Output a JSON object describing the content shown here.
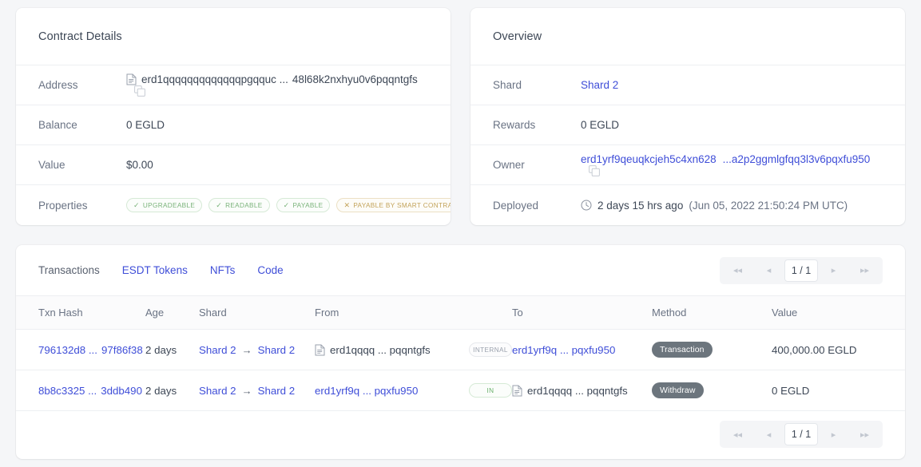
{
  "contract_details": {
    "title": "Contract Details",
    "rows": [
      {
        "label": "Address",
        "value_prefix": "erd1qqqqqqqqqqqqqpgqquc ...",
        "value_suffix": "48l68k2nxhyu0v6pqqntgfs",
        "icon": "document-icon",
        "copy_icon": "copy-icon"
      },
      {
        "label": "Balance",
        "value": "0 EGLD"
      },
      {
        "label": "Value",
        "value": "$0.00"
      }
    ],
    "properties_label": "Properties",
    "properties": [
      {
        "label": "UPGRADEABLE",
        "state": "ok",
        "glyph": "✓"
      },
      {
        "label": "READABLE",
        "state": "ok",
        "glyph": "✓"
      },
      {
        "label": "PAYABLE",
        "state": "ok",
        "glyph": "✓"
      },
      {
        "label": "PAYABLE BY SMART CONTRACT",
        "state": "no",
        "glyph": "✕"
      }
    ]
  },
  "overview": {
    "title": "Overview",
    "shard_label": "Shard",
    "shard_value": "Shard 2",
    "rewards_label": "Rewards",
    "rewards_value": "0 EGLD",
    "owner_label": "Owner",
    "owner_prefix": "erd1yrf9qeuqkcjeh5c4xn628",
    "owner_suffix": "...a2p2ggmlgfqq3l3v6pqxfu950",
    "owner_copy_icon": "copy-icon",
    "deployed_label": "Deployed",
    "deployed_icon": "clock-icon",
    "deployed_relative": "2 days 15 hrs ago",
    "deployed_absolute": "(Jun 05, 2022 21:50:24 PM UTC)"
  },
  "tabs": [
    {
      "label": "Transactions",
      "active": true
    },
    {
      "label": "ESDT Tokens",
      "active": false
    },
    {
      "label": "NFTs",
      "active": false
    },
    {
      "label": "Code",
      "active": false
    }
  ],
  "pagination": {
    "first_icon": "◂◂",
    "prev_icon": "◂",
    "current": "1 / 1",
    "next_icon": "▸",
    "last_icon": "▸▸"
  },
  "table": {
    "headers": [
      "Txn Hash",
      "Age",
      "Shard",
      "From",
      "To",
      "Method",
      "Value"
    ],
    "rows": [
      {
        "hash_prefix": "796132d8 ...",
        "hash_suffix": "97f86f38",
        "age": "2 days",
        "shard_from": "Shard 2",
        "shard_arrow": "→",
        "shard_to": "Shard 2",
        "from_address": "erd1qqqq ... pqqntgfs",
        "from_is_link": false,
        "from_has_doc_icon": true,
        "direction": "INTERNAL",
        "direction_kind": "internal",
        "to_address": "erd1yrf9q ... pqxfu950",
        "to_is_link": true,
        "to_has_doc_icon": false,
        "method": "Transaction",
        "value": "400,000.00 EGLD"
      },
      {
        "hash_prefix": "8b8c3325 ...",
        "hash_suffix": "3ddb490",
        "age": "2 days",
        "shard_from": "Shard 2",
        "shard_arrow": "→",
        "shard_to": "Shard 2",
        "from_address": "erd1yrf9q ... pqxfu950",
        "from_is_link": true,
        "from_has_doc_icon": false,
        "direction": "IN",
        "direction_kind": "in",
        "to_address": "erd1qqqq ... pqqntgfs",
        "to_is_link": false,
        "to_has_doc_icon": true,
        "method": "Withdraw",
        "value": "0 EGLD"
      }
    ]
  },
  "colors": {
    "link": "#3f4ed8",
    "page_bg": "#f5f6f8",
    "card_bg": "#ffffff",
    "text": "#3d4756",
    "muted": "#6a7384",
    "badge_green": "#7ab37a",
    "badge_orange": "#c3a35a",
    "method_pill": "#6c757d"
  }
}
